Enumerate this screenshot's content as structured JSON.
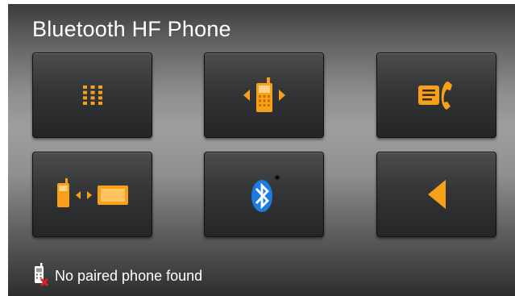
{
  "header": {
    "title": "Bluetooth HF Phone"
  },
  "buttons": [
    {
      "name": "dial-keypad-button",
      "icon": "keypad-icon"
    },
    {
      "name": "phone-select-button",
      "icon": "phone-arrows-icon"
    },
    {
      "name": "phonebook-button",
      "icon": "phonebook-call-icon"
    },
    {
      "name": "phone-pairing-button",
      "icon": "phone-to-device-icon"
    },
    {
      "name": "bluetooth-settings-button",
      "icon": "bluetooth-icon"
    },
    {
      "name": "back-button",
      "icon": "back-arrow-icon"
    }
  ],
  "status": {
    "text": "No paired phone found",
    "icon": "phone-disconnected-icon"
  },
  "colors": {
    "accent": "#f7a11a",
    "bluetooth": "#1e7be0",
    "warning": "#e02020"
  }
}
